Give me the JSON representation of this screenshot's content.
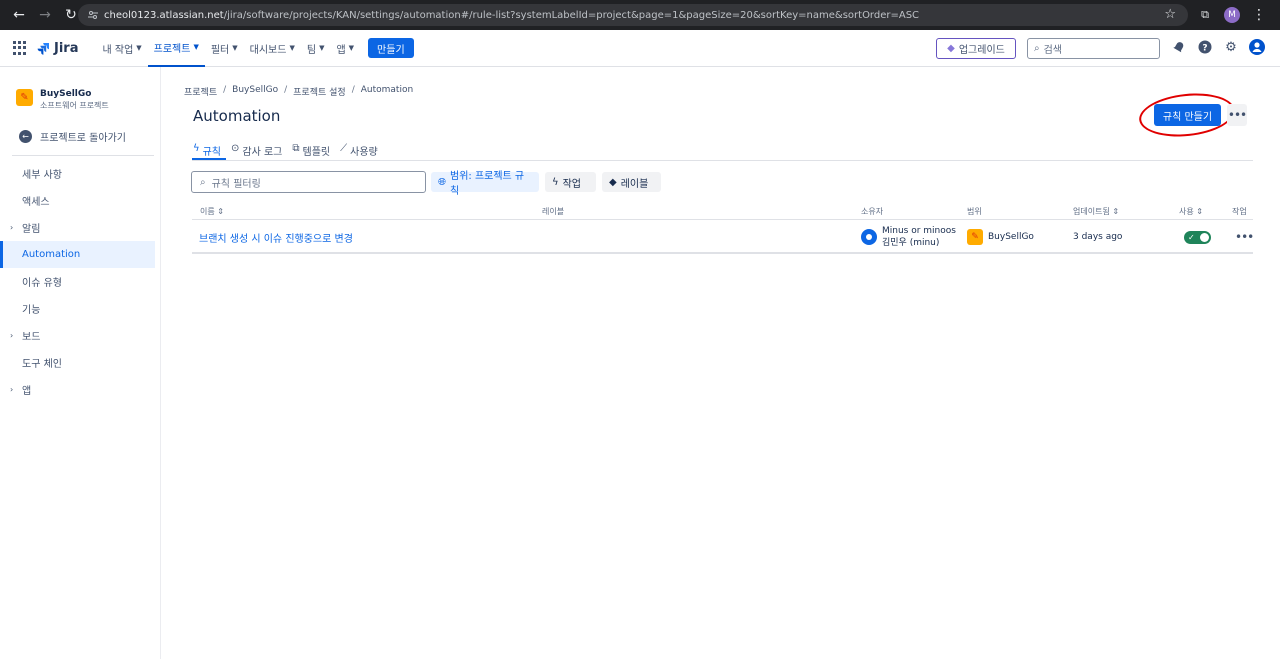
{
  "browser": {
    "url_host": "cheol0123.atlassian.net",
    "url_path": "/jira/software/projects/KAN/settings/automation#/rule-list?systemLabelId=project&page=1&pageSize=20&sortKey=name&sortOrder=ASC",
    "profile_initial": "M"
  },
  "topnav": {
    "logo": "Jira",
    "items": [
      {
        "label": "내 작업"
      },
      {
        "label": "프로젝트"
      },
      {
        "label": "필터"
      },
      {
        "label": "대시보드"
      },
      {
        "label": "팀"
      },
      {
        "label": "앱"
      }
    ],
    "create_label": "만들기",
    "upgrade_label": "업그레이드",
    "search_placeholder": "검색"
  },
  "sidebar": {
    "project_name": "BuySellGo",
    "project_type": "소프트웨어 프로젝트",
    "back_label": "프로젝트로 돌아가기",
    "items": [
      {
        "label": "세부 사항"
      },
      {
        "label": "액세스"
      },
      {
        "label": "알림"
      },
      {
        "label": "Automation"
      },
      {
        "label": "이슈 유형"
      },
      {
        "label": "기능"
      },
      {
        "label": "보드"
      },
      {
        "label": "도구 체인"
      },
      {
        "label": "앱"
      }
    ]
  },
  "breadcrumb": [
    "프로젝트",
    "BuySellGo",
    "프로젝트 설정",
    "Automation"
  ],
  "page_title": "Automation",
  "create_rule_label": "규칙 만들기",
  "tabs": [
    {
      "label": "규칙"
    },
    {
      "label": "감사 로그"
    },
    {
      "label": "템플릿"
    },
    {
      "label": "사용량"
    }
  ],
  "filter": {
    "placeholder": "규칙 필터링",
    "scope_chip": "범위: 프로젝트 규칙",
    "action_chip": "작업",
    "label_chip": "레이블"
  },
  "table": {
    "headers": {
      "name": "이름",
      "label": "레이블",
      "owner": "소유자",
      "scope": "범위",
      "updated": "업데이트됨",
      "enabled": "사용",
      "actions": "작업"
    },
    "rows": [
      {
        "name": "브랜치 생성 시 이슈 진행중으로 변경",
        "owner_line1": "Minus or minoos",
        "owner_line2": "김민우 (minu)",
        "scope": "BuySellGo",
        "updated": "3 days ago",
        "enabled": true
      }
    ]
  },
  "colors": {
    "accent": "#0c66e4",
    "toggle_on": "#1f845a",
    "annotation": "#e00000"
  }
}
